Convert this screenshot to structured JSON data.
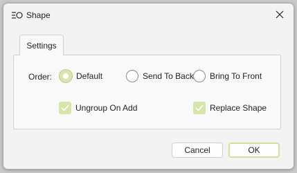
{
  "window": {
    "title": "Shape",
    "icon": "shape-icon"
  },
  "tabs": [
    {
      "label": "Settings",
      "active": true
    }
  ],
  "order": {
    "label": "Order:",
    "options": [
      {
        "label": "Default",
        "checked": true
      },
      {
        "label": "Send To Back",
        "checked": false
      },
      {
        "label": "Bring To Front",
        "checked": false
      }
    ]
  },
  "checkboxes": [
    {
      "label": "Ungroup On Add",
      "checked": true
    },
    {
      "label": "Replace Shape",
      "checked": true
    }
  ],
  "buttons": {
    "cancel": "Cancel",
    "ok": "OK"
  },
  "colors": {
    "accent": "#d6e5aa",
    "background": "#f3f3f3"
  }
}
